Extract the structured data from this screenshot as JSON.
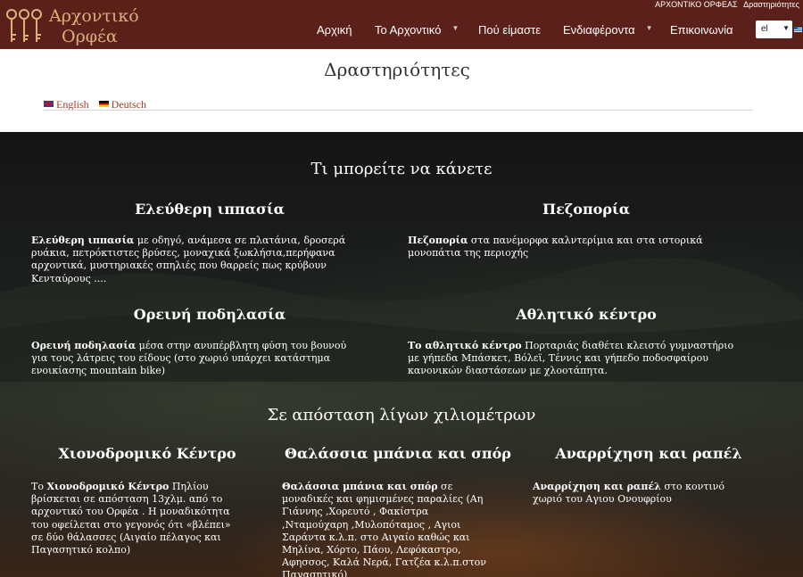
{
  "logo": {
    "line1": "Αρχοντικό",
    "line2": "Ορφέα"
  },
  "breadcrumb": {
    "site": "ΑΡΧΟΝΤΙΚΟ ΟΡΦΕΑΣ",
    "current": "Δραστηριότητες"
  },
  "nav": [
    {
      "label": "Αρχική",
      "has_dropdown": false
    },
    {
      "label": "Το Αρχοντικό",
      "has_dropdown": true
    },
    {
      "label": "Πού είμαστε",
      "has_dropdown": false
    },
    {
      "label": "Ενδιαφέροντα",
      "has_dropdown": true
    },
    {
      "label": "Επικοινωνία",
      "has_dropdown": false
    }
  ],
  "language_select": {
    "value": "el"
  },
  "page_title": "Δραστηριότητες",
  "languages": [
    {
      "label": "English",
      "flag": "uk-flag-icon"
    },
    {
      "label": "Deutsch",
      "flag": "de-flag-icon"
    }
  ],
  "sections": {
    "heading1": "Τι μπορείτε να κάνετε",
    "heading2": "Σε απόσταση λίγων χιλιομέτρων"
  },
  "activities": [
    {
      "title": "Ελεύθερη ιππασία",
      "bold": "Ελεύθερη ιππασία",
      "text": " με οδηγό, ανάμεσα σε πλατάνια, δροσερά ρυάκια, πετρόκτιστες  βρύσες, μοναχικά ξωκλήσια,περήφανα αρχοντικά, μυστηριακές σπηλιές που θαρρείς πως κρύβουν Κενταύρους ...."
    },
    {
      "title": "Πεζοπορία",
      "bold": "Πεζοπορία",
      "text": " στα πανέμορφα καλντερίμια και στα ιστορικά μονοπάτια της περιοχής"
    },
    {
      "title": "Ορεινή ποδηλασία",
      "bold": "Ορεινή ποδηλασία",
      "text": " μέσα στην ανυπέρβλητη φύση του βουνού για τους λάτρεις του είδους (στο χωριό υπάρχει κατάστημα ενοικίασης mountain bike)"
    },
    {
      "title": "Αθλητικό κέντρο",
      "bold": "Το αθλητικό κέντρο",
      "text": " Πορταριάς διαθέτει κλειστό γυμναστήριο με γήπεδα Μπάσκετ, Βόλεϊ, Τέννις και  γήπεδο ποδοσφαίρου  κανονικών διαστάσεων με χλοοτάπητα."
    }
  ],
  "nearby": [
    {
      "title": "Χιονοδρομικό Κέντρο",
      "prefix": "Το ",
      "bold": "Χιονοδρομικό Κέντρο",
      "text": " Πηλίου βρίσκεται σε απόσταση 13χλμ. από το αρχοντικό του Ορφέα . Η μοναδικότητα του οφείλεται στο γεγονός ότι «βλέπει» σε δύο θάλασσες (Αιγαίο πέλαγος και Παγασητικό κολπο)"
    },
    {
      "title": "Θαλάσσια μπάνια και σπόρ",
      "prefix": "",
      "bold": "Θαλάσσια μπάνια και σπόρ",
      "text": " σε μοναδικές και φημισμένες παραλίες (Αη Γιάννης ,Χορευτό , Φακίστρα ,Νταμούχαρη ,Μυλοπόταμος , Αγιοι Σαράντα κ.λ.π. στο Αιγαίο καθώς και Μηλίνα, Χόρτο, Πάου, Λεφόκαστρο, Αφησσος, Καλά Νερά, Γατζέα κ.λ.π.στον Παγασητικό)"
    },
    {
      "title": "Αναρρίχηση και ραπέλ",
      "prefix": "",
      "bold": "Αναρρίχηση και ραπέλ",
      "text": " στο κοντινό χωριό του Αγιου Ονουφρίου"
    }
  ],
  "colors": {
    "header_bg": "#5a2019",
    "logo_gold": "#d9b27a",
    "link": "#9c3f2a"
  }
}
